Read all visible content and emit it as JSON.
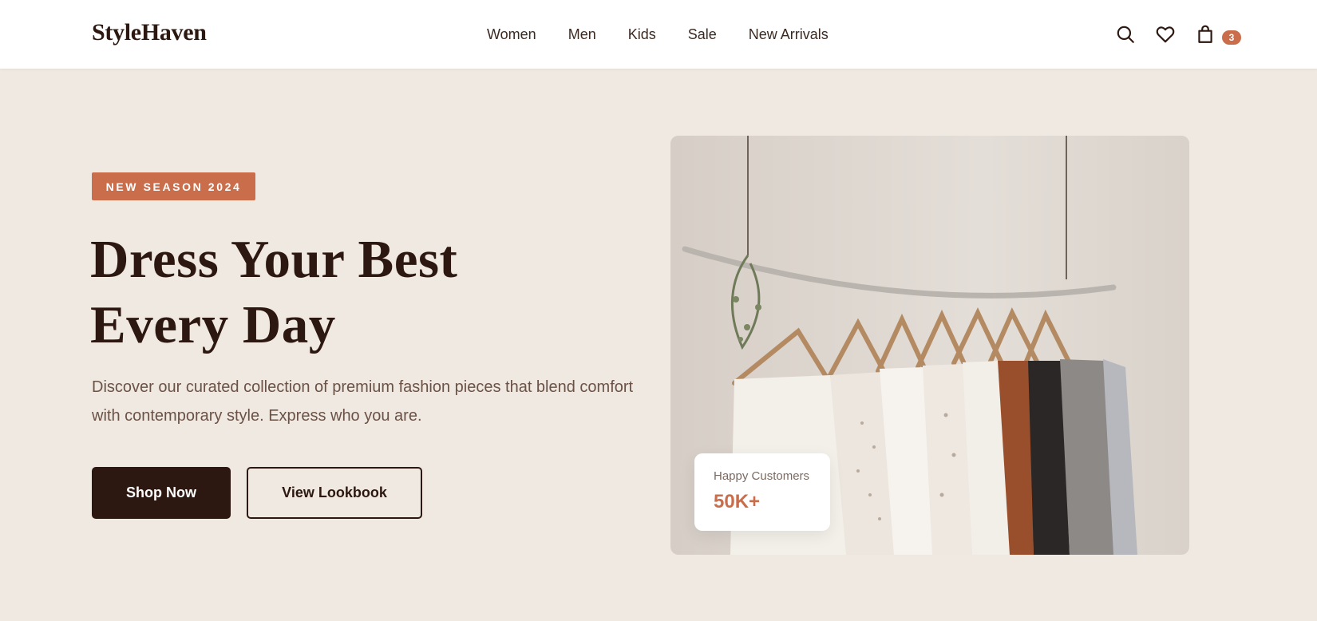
{
  "brand": {
    "name": "StyleHaven"
  },
  "nav": {
    "links": [
      {
        "label": "Women"
      },
      {
        "label": "Men"
      },
      {
        "label": "Kids"
      },
      {
        "label": "Sale"
      },
      {
        "label": "New Arrivals"
      }
    ],
    "icons": {
      "search": "search-icon",
      "wishlist": "heart-icon",
      "cart": "shopping-bag-icon"
    },
    "cart_count": "3"
  },
  "hero": {
    "badge": "NEW SEASON 2024",
    "headline_line1": "Dress Your Best",
    "headline_line2": "Every Day",
    "description": "Discover our curated collection of premium fashion pieces that blend comfort with contemporary style. Express who you are.",
    "primary_button": "Shop Now",
    "secondary_button": "View Lookbook",
    "image_subject": "clothing rack with garments on wooden hangers"
  },
  "stat": {
    "label": "Happy Customers",
    "value": "50K+"
  },
  "colors": {
    "background": "#efe9e1",
    "accent": "#c96d4b",
    "dark": "#2c1810",
    "body_text": "#6b5247"
  }
}
